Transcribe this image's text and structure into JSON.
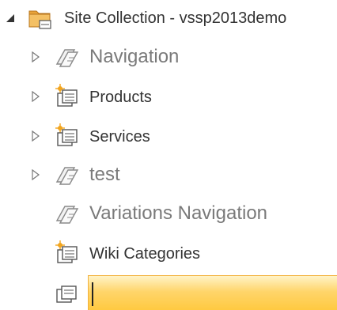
{
  "tree": {
    "root": {
      "label": "Site Collection - vssp2013demo",
      "expanded": true,
      "icon": "folder-site-icon"
    },
    "items": [
      {
        "label": "Navigation",
        "icon": "term-set-icon",
        "expandable": true
      },
      {
        "label": "Products",
        "icon": "term-store-group-icon",
        "expandable": true
      },
      {
        "label": "Services",
        "icon": "term-store-group-icon",
        "expandable": true
      },
      {
        "label": "test",
        "icon": "term-set-icon",
        "expandable": true
      },
      {
        "label": "Variations Navigation",
        "icon": "term-set-icon",
        "expandable": false
      },
      {
        "label": "Wiki Categories",
        "icon": "term-store-group-icon",
        "expandable": false
      }
    ],
    "new_item": {
      "icon": "term-set-icon",
      "value": ""
    }
  },
  "colors": {
    "edit_box_border": "#f2b13b",
    "edit_box_fill": "#ffcf55",
    "muted_label": "#7a7a7a",
    "label": "#333333"
  }
}
